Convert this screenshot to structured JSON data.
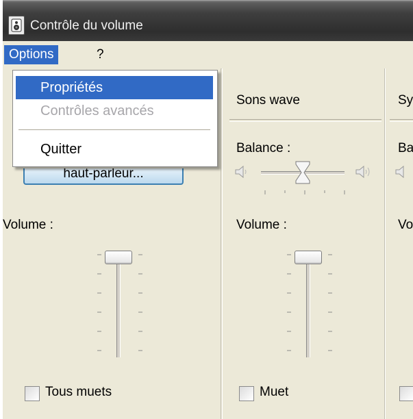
{
  "window": {
    "title": "Contrôle du volume"
  },
  "menubar": {
    "options_label": "Options",
    "help_label": "?"
  },
  "options_menu": {
    "items": [
      {
        "label": "Propriétés",
        "state": "selected"
      },
      {
        "label": "Contrôles avancés",
        "state": "disabled"
      },
      {
        "label": "Quitter",
        "state": "normal"
      }
    ]
  },
  "channels": [
    {
      "advanced_button": "haut-parleur...",
      "volume_label": "Volume :",
      "volume_level": 1.0,
      "mute_label": "Tous muets",
      "mute_checked": false
    },
    {
      "name": "Sons wave",
      "balance_label": "Balance :",
      "balance_level": 0.5,
      "volume_label": "Volume :",
      "volume_level": 1.0,
      "mute_label": "Muet",
      "mute_checked": false
    },
    {
      "name": "Sy",
      "balance_label": "Ba",
      "volume_label": "Vo"
    }
  ],
  "colors": {
    "highlight": "#316ac5",
    "face": "#ece9d8",
    "title_bar": "#3a3a3a"
  }
}
